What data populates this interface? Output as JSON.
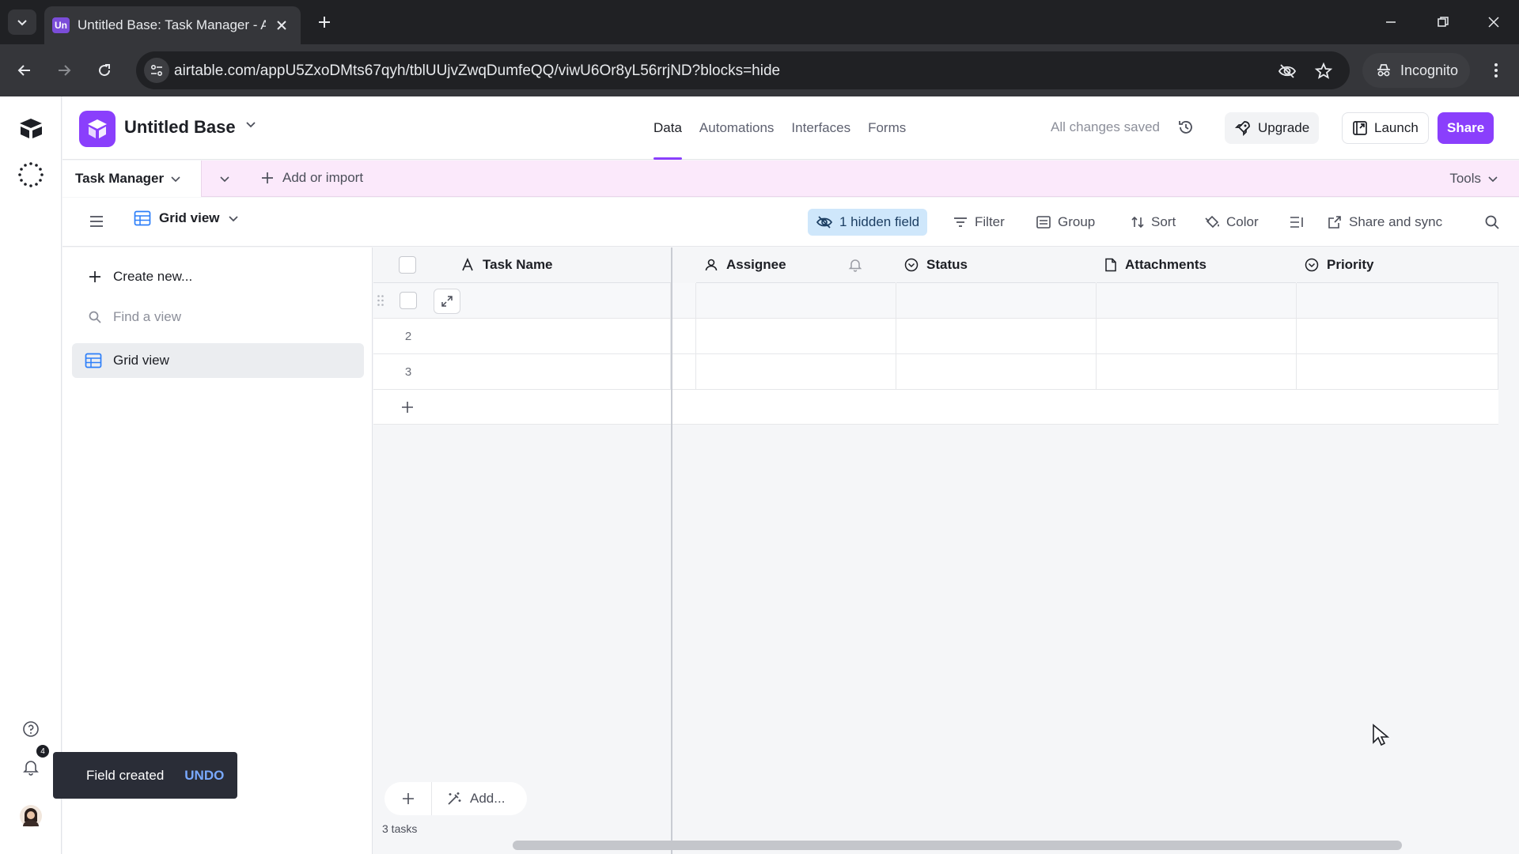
{
  "browser": {
    "tab_favicon": "Un",
    "tab_title": "Untitled Base: Task Manager - A",
    "url": "airtable.com/appU5ZxoDMts67qyh/tblUUjvZwqDumfeQQ/viwU6Or8yL56rrjND?blocks=hide",
    "incognito_label": "Incognito"
  },
  "header": {
    "base_name": "Untitled Base",
    "tabs": [
      {
        "label": "Data",
        "active": true
      },
      {
        "label": "Automations"
      },
      {
        "label": "Interfaces"
      },
      {
        "label": "Forms"
      }
    ],
    "saved_status": "All changes saved",
    "upgrade_label": "Upgrade",
    "launch_label": "Launch",
    "share_label": "Share",
    "accent_color": "#8a3ffc"
  },
  "tablebar": {
    "table_name": "Task Manager",
    "add_import_label": "Add or import",
    "tools_label": "Tools"
  },
  "viewbar": {
    "view_name": "Grid view",
    "hidden_fields_label": "1 hidden field",
    "filter_label": "Filter",
    "group_label": "Group",
    "sort_label": "Sort",
    "color_label": "Color",
    "share_sync_label": "Share and sync"
  },
  "sidebar": {
    "create_new_label": "Create new...",
    "find_placeholder": "Find a view",
    "views": [
      {
        "label": "Grid view"
      }
    ]
  },
  "grid": {
    "columns": [
      {
        "label": "Task Name",
        "icon": "text-type-icon"
      },
      {
        "label": "Assignee",
        "icon": "user-icon"
      },
      {
        "label": "Status",
        "icon": "single-select-icon"
      },
      {
        "label": "Attachments",
        "icon": "document-icon"
      },
      {
        "label": "Priority",
        "icon": "single-select-icon"
      }
    ],
    "rows": [
      {
        "number": ""
      },
      {
        "number": "2"
      },
      {
        "number": "3"
      }
    ],
    "add_label": "Add...",
    "record_count": "3 tasks"
  },
  "rail": {
    "notification_count": "4"
  },
  "toast": {
    "message": "Field created",
    "action": "UNDO"
  }
}
